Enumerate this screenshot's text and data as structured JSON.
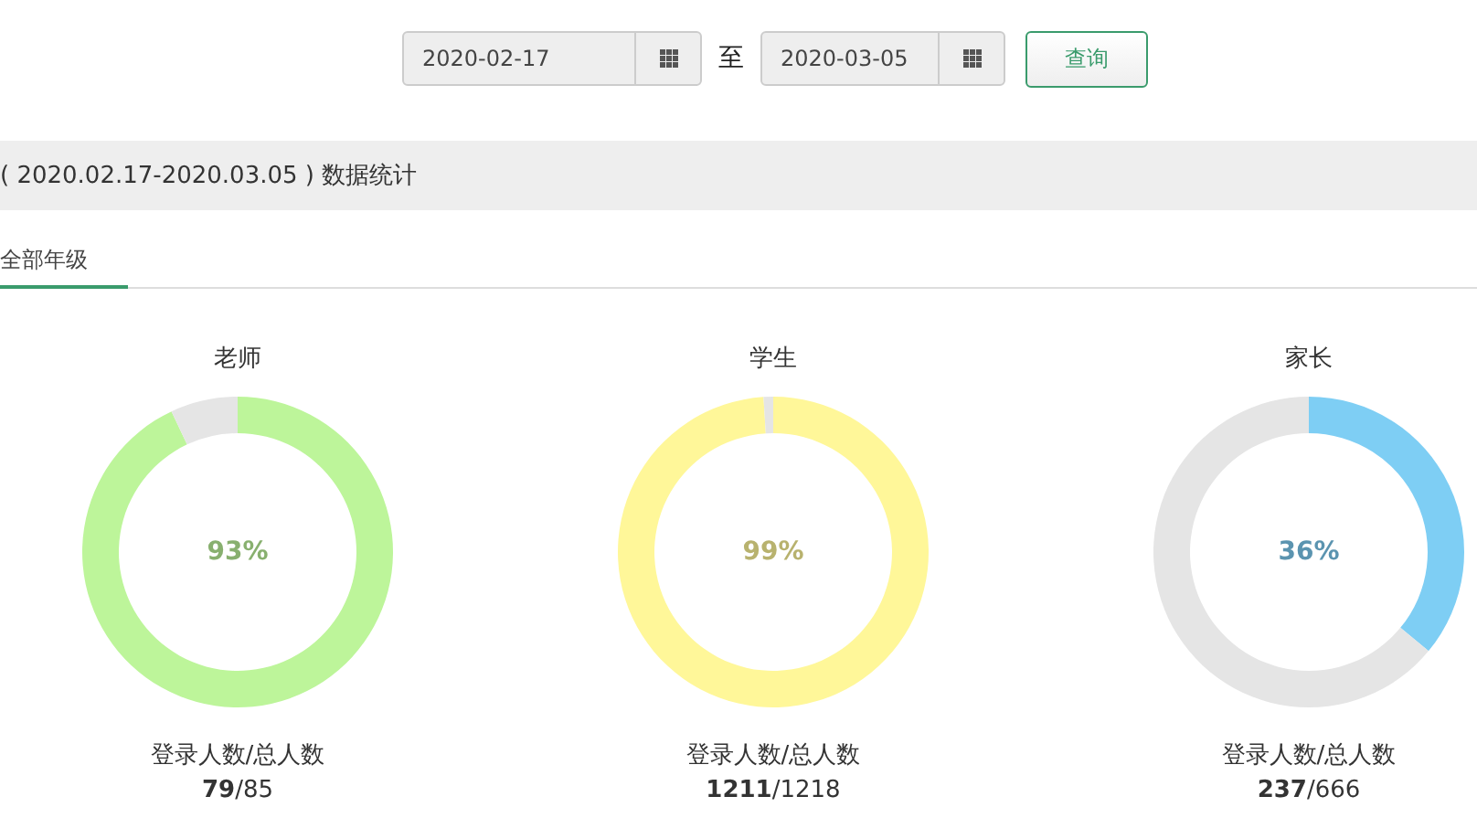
{
  "date_range": {
    "start": "2020-02-17",
    "separator": "至",
    "end": "2020-03-05",
    "button": "查询"
  },
  "section_title": "( 2020.02.17-2020.03.05 ) 数据统计",
  "tabs": [
    {
      "label": "全部年级",
      "selected": true
    }
  ],
  "stats": [
    {
      "title": "老师",
      "chart_data": {
        "type": "donut",
        "values": [
          93,
          7
        ]
      },
      "percent": "93%",
      "color": "#bdf59a",
      "caption": "登录人数/总人数",
      "count": "**79**/85"
    },
    {
      "title": "学生",
      "chart_data": {
        "type": "donut",
        "values": [
          99,
          1
        ]
      },
      "percent": "99%",
      "color": "#fff799",
      "caption": "登录人数/总人数",
      "count": "**1211**/1218"
    },
    {
      "title": "家长",
      "chart_data": {
        "type": "donut",
        "values": [
          36,
          64
        ]
      },
      "percent": "36%",
      "color": "#7ecef4",
      "caption": "登录人数/总人数",
      "count": "**237**/666"
    }
  ]
}
